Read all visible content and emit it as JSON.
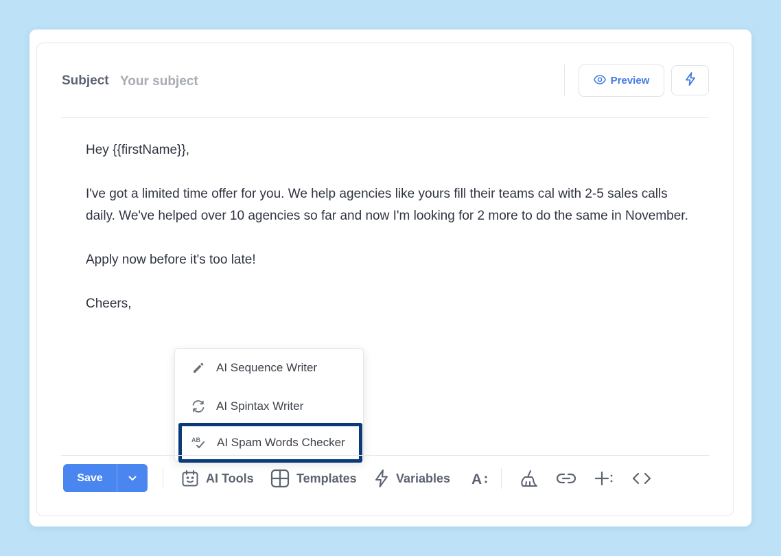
{
  "subject": {
    "label": "Subject",
    "placeholder": "Your subject",
    "value": ""
  },
  "header": {
    "preview_label": "Preview"
  },
  "body": {
    "greeting": "Hey {{firstName}},",
    "paragraph": "I've got a limited time offer for you. We help agencies like yours fill their teams cal with 2-5 sales calls daily. We've helped over 10 agencies so far and now I'm looking for 2 more to do the same in November.",
    "cta": "Apply now before it's too late!",
    "signoff": "Cheers,"
  },
  "ai_menu": {
    "items": [
      {
        "label": "AI Sequence Writer",
        "icon": "pencil-icon"
      },
      {
        "label": "AI Spintax Writer",
        "icon": "refresh-icon"
      },
      {
        "label": "AI Spam Words Checker",
        "icon": "spellcheck-icon",
        "highlighted": true
      }
    ]
  },
  "toolbar": {
    "save_label": "Save",
    "ai_tools_label": "AI Tools",
    "templates_label": "Templates",
    "variables_label": "Variables"
  },
  "colors": {
    "background": "#bde2f7",
    "accent": "#4a86f0",
    "link": "#3f7ae0",
    "highlight_border": "#0b3a78"
  }
}
